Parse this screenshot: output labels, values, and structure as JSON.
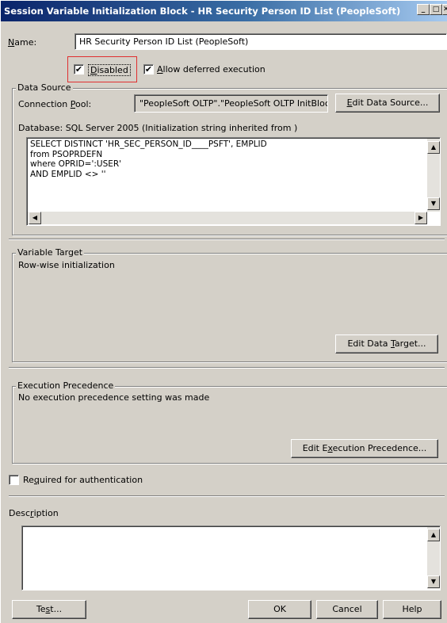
{
  "window": {
    "title": "Session Variable Initialization Block - HR Security Person ID List (PeopleSoft)"
  },
  "name": {
    "label_pre": "",
    "label_ul": "N",
    "label_post": "ame:",
    "value": "HR Security Person ID List (PeopleSoft)"
  },
  "options": {
    "disabled": {
      "ul": "D",
      "rest": "isabled",
      "checked": "✔"
    },
    "deferred": {
      "ul": "A",
      "rest": "llow deferred execution",
      "checked": "✔"
    }
  },
  "data_source": {
    "title": "Data Source",
    "conn_label_pre": "Connection ",
    "conn_label_ul": "P",
    "conn_label_post": "ool:",
    "conn_value": "\"PeopleSoft OLTP\".\"PeopleSoft OLTP InitBlock",
    "edit_pre": "",
    "edit_ul": "E",
    "edit_post": "dit Data Source...",
    "database": "Database: SQL Server 2005 (Initialization string inherited from )",
    "sql": "SELECT DISTINCT 'HR_SEC_PERSON_ID____PSFT', EMPLID\nfrom PSOPRDEFN\nwhere OPRID=':USER'\nAND EMPLID <> ''"
  },
  "variable_target": {
    "title": "Variable Target",
    "desc": "Row-wise initialization",
    "edit_pre": "Edit Data ",
    "edit_ul": "T",
    "edit_post": "arget..."
  },
  "execution_precedence": {
    "title": "Execution Precedence",
    "desc": "No execution precedence setting was made",
    "edit_pre": "Edit E",
    "edit_ul": "x",
    "edit_post": "ecution Precedence..."
  },
  "required": {
    "pre": "Re",
    "ul": "q",
    "post": "uired for authentication",
    "checked": ""
  },
  "description": {
    "pre": "Desc",
    "ul": "r",
    "post": "iption",
    "value": ""
  },
  "footer": {
    "test_pre": "Te",
    "test_ul": "s",
    "test_post": "t...",
    "ok": "OK",
    "cancel": "Cancel",
    "help": "Help"
  },
  "icons": {
    "up": "▲",
    "down": "▼",
    "left": "◀",
    "right": "▶",
    "minimize": "_",
    "maximize": "□",
    "close": "✕"
  }
}
